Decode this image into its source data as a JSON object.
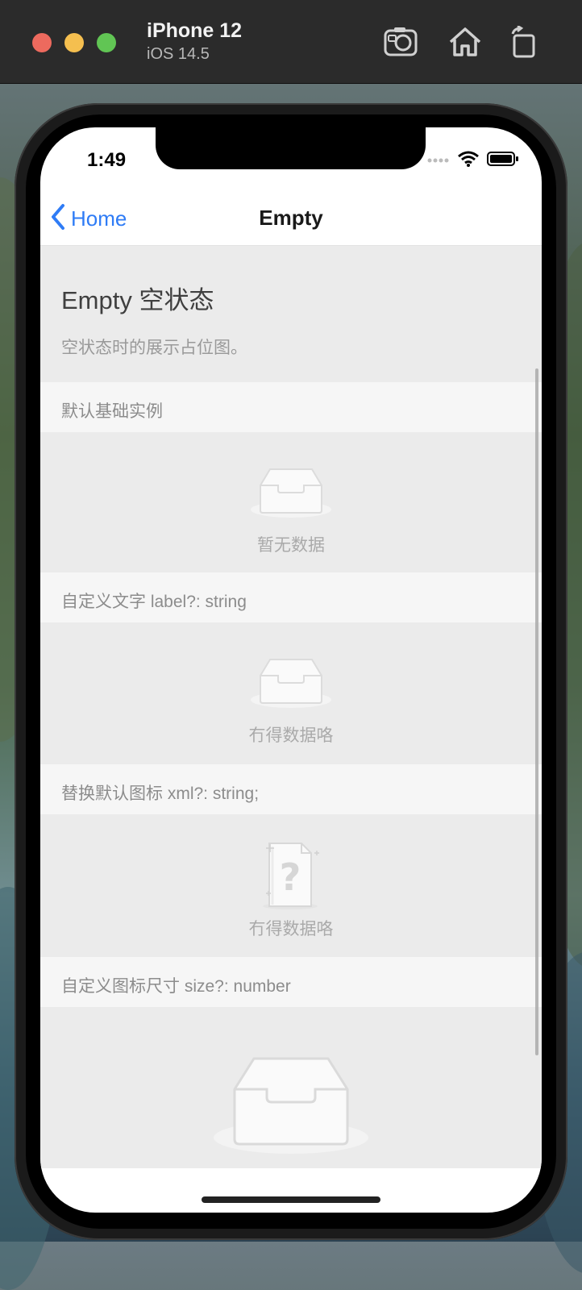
{
  "simulator": {
    "device_name": "iPhone 12",
    "os_version": "iOS 14.5",
    "tools": [
      "screenshot-icon",
      "home-icon",
      "rotate-icon"
    ]
  },
  "status_bar": {
    "time": "1:49"
  },
  "navbar": {
    "back_label": "Home",
    "title": "Empty"
  },
  "page": {
    "title": "Empty 空状态",
    "description": "空状态时的展示占位图。"
  },
  "sections": [
    {
      "header": "默认基础实例",
      "empty_label": "暂无数据",
      "icon": "inbox-tray-icon"
    },
    {
      "header": "自定义文字 label?: string",
      "empty_label": "冇得数据咯",
      "icon": "inbox-tray-icon"
    },
    {
      "header": "替换默认图标 xml?: string;",
      "empty_label": "冇得数据咯",
      "icon": "question-document-icon"
    },
    {
      "header": "自定义图标尺寸 size?: number",
      "icon": "inbox-tray-icon-large"
    }
  ],
  "colors": {
    "accent": "#2f7cf6",
    "section_bg": "#ebebeb",
    "header_bg": "#f6f6f6",
    "muted_text": "#aaaaaa"
  }
}
